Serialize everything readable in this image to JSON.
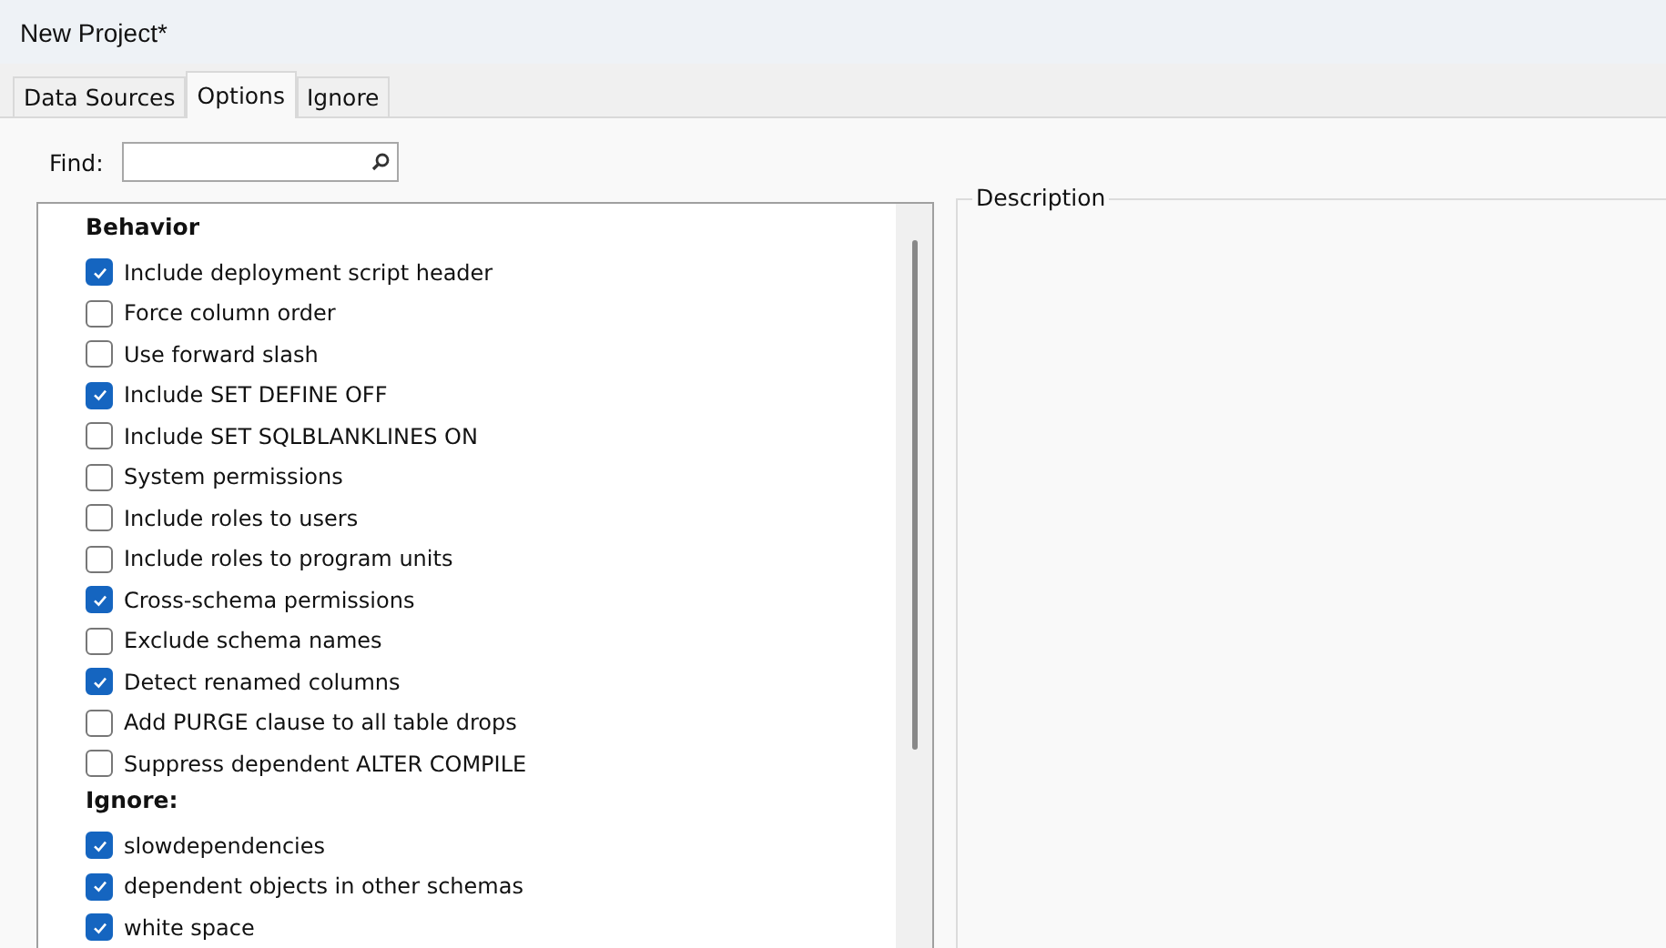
{
  "window": {
    "title": "New Project*"
  },
  "tabs": [
    {
      "label": "Data Sources",
      "selected": false
    },
    {
      "label": "Options",
      "selected": true
    },
    {
      "label": "Ignore",
      "selected": false
    }
  ],
  "find": {
    "label": "Find:"
  },
  "sections": [
    {
      "heading": "Behavior",
      "items": [
        {
          "label": "Include deployment script header",
          "checked": true
        },
        {
          "label": "Force column order",
          "checked": false
        },
        {
          "label": "Use forward slash",
          "checked": false
        },
        {
          "label": "Include SET DEFINE OFF",
          "checked": true
        },
        {
          "label": "Include SET SQLBLANKLINES ON",
          "checked": false
        },
        {
          "label": "System permissions",
          "checked": false
        },
        {
          "label": "Include roles to users",
          "checked": false
        },
        {
          "label": "Include roles to program units",
          "checked": false
        },
        {
          "label": "Cross-schema permissions",
          "checked": true
        },
        {
          "label": "Exclude schema names",
          "checked": false
        },
        {
          "label": "Detect renamed columns",
          "checked": true
        },
        {
          "label": "Add PURGE clause to all table drops",
          "checked": false
        },
        {
          "label": "Suppress dependent ALTER COMPILE",
          "checked": false
        }
      ]
    },
    {
      "heading": "Ignore:",
      "items": [
        {
          "label": "slowdependencies",
          "checked": true
        },
        {
          "label": "dependent objects in other schemas",
          "checked": true
        },
        {
          "label": "white space",
          "checked": true
        }
      ]
    }
  ],
  "description": {
    "title": "Description"
  }
}
